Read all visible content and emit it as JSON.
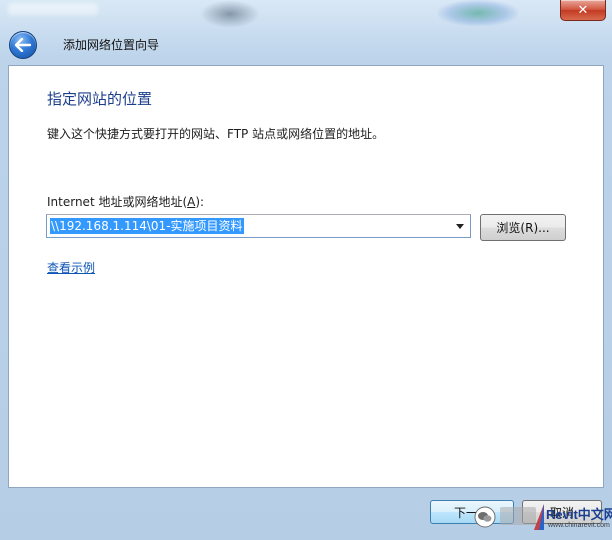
{
  "window": {
    "title": "添加网络位置向导",
    "close_glyph": "✕"
  },
  "page": {
    "heading": "指定网站的位置",
    "instruction": "键入这个快捷方式要打开的网站、FTP 站点或网络位置的地址。",
    "address_label_prefix": "Internet 地址或网络地址(",
    "address_label_key": "A",
    "address_label_suffix": "):",
    "address_value": "\\\\192.168.1.114\\01-实施项目资料",
    "browse_label": "浏览(R)...",
    "example_link": "查看示例"
  },
  "footer": {
    "next_label": "下一步",
    "cancel_label": "取消"
  },
  "watermark": {
    "brand": "Revit中文网",
    "url": "www.chinarevit.com"
  },
  "icons": {
    "back": "back-arrow-icon",
    "close": "close-icon",
    "dropdown": "chevron-down-icon",
    "wechat": "wechat-icon",
    "brand_logo": "revit-logo-icon"
  },
  "colors": {
    "heading": "#1c3e8a",
    "link": "#0d55b5",
    "selection": "#3399ff",
    "close_button": "#c23a22"
  }
}
